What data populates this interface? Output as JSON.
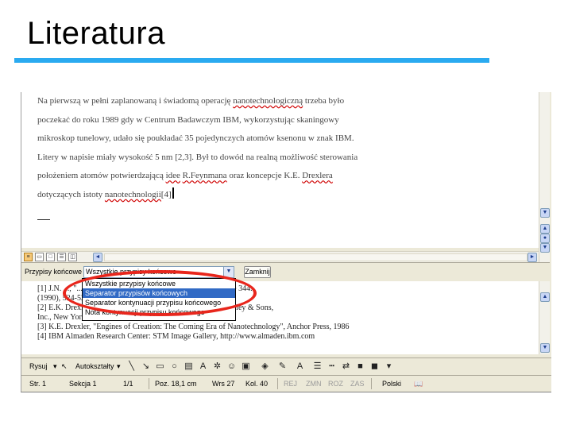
{
  "slide": {
    "title": "Literatura",
    "accent_color": "#2aaaf0"
  },
  "document": {
    "line1": "Na pierwszą w pełni zaplanowaną i świadomą operację",
    "line1_wavy": "nanotechnologiczną",
    "line1_end": "trzeba było",
    "line2": "poczekać do roku 1989 gdy w Centrum Badawczym IBM, wykorzystując skaningowy",
    "line3": "mikroskop tunelowy, udało się poukładać 35 pojedynczych atomów ksenonu w znak IBM.",
    "line4": "Litery w napisie miały wysokość 5 nm [2,3]. Był to dowód na realną możliwość sterowania",
    "line5_start": "położeniem atomów potwierdzającą",
    "line5_wavy1": "idee",
    "line5_wavy2": "R.Feynmana",
    "line5_mid": "oraz koncepcje K.E.",
    "line5_wavy3": "Drexlera",
    "line6_start": "dotyczących istoty",
    "line6_wavy": "nanotechnologii",
    "line6_cite": "[4]"
  },
  "notes_bar": {
    "label": "Przypisy końcowe",
    "selected": "Wszystkie przypisy końcowe",
    "close": "Zamknij",
    "options": [
      "Wszystkie przypisy końcowe",
      "Separator przypisów końcowych",
      "Separator kontynuacji przypisu końcowego",
      "Nota kontynuacji przypisu końcowego"
    ]
  },
  "notes": [
    "[1] J.N. ..., \"...\" with a scanning tunneling microscope), Nature 344.",
    "(1990), 524-526",
    "[2] E.K. Drexler, \"... Manufacturing and Computing\", John Wiley & Sons,",
    "Inc., New York, 1992",
    "[3] K.E. Drexler, \"Engines of Creation: The Coming Era of Nanotechnology\", Anchor Press, 1986",
    "[4] IBM Almaden Research Center: STM Image Gallery, http://www.almaden.ibm.com"
  ],
  "drawing_bar": {
    "draw": "Rysuj",
    "autoshapes": "Autokształty"
  },
  "status_bar": {
    "page": "Str. 1",
    "section": "Sekcja 1",
    "pages": "1/1",
    "position": "Poz. 18,1 cm",
    "line": "Wrs 27",
    "column": "Kol. 40",
    "rec": "REJ",
    "trk": "ZMN",
    "ext": "ROZ",
    "ovr": "ZAS",
    "lang": "Polski"
  }
}
